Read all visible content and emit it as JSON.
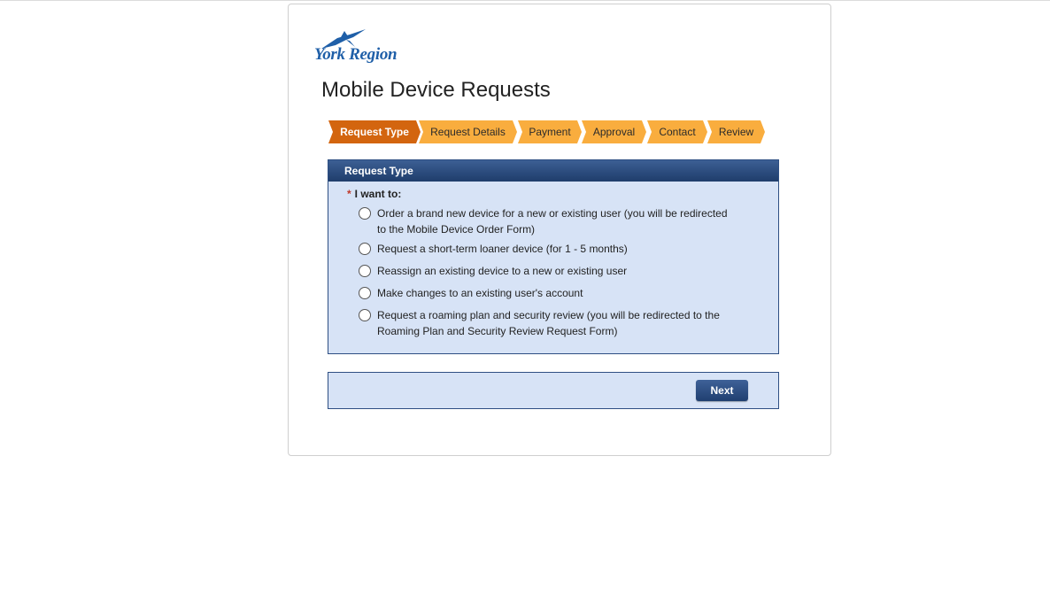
{
  "brand": {
    "logo_text": "York Region",
    "logo_color": "#1f5fa8",
    "logo_icon": "bird-icon"
  },
  "page": {
    "title": "Mobile Device Requests"
  },
  "steps": [
    {
      "label": "Request Type",
      "active": true
    },
    {
      "label": "Request Details",
      "active": false
    },
    {
      "label": "Payment",
      "active": false
    },
    {
      "label": "Approval",
      "active": false
    },
    {
      "label": "Contact",
      "active": false
    },
    {
      "label": "Review",
      "active": false
    }
  ],
  "colors": {
    "step_active": "#d3650f",
    "step_inactive": "#f9ad3e",
    "panel_header": "#2e4f83",
    "panel_bg": "#d7e3f6",
    "required": "#c0392b"
  },
  "request_type": {
    "header": "Request Type",
    "required_marker": "*",
    "question": "I want to:",
    "options": [
      {
        "label": "Order a brand new device for a new or existing user (you will be redirected to the Mobile Device Order Form)",
        "selected": false
      },
      {
        "label": "Request a short-term loaner device (for 1 - 5 months)",
        "selected": false
      },
      {
        "label": "Reassign an existing device to a new or existing user",
        "selected": false
      },
      {
        "label": "Make changes to an existing user's account",
        "selected": false
      },
      {
        "label": "Request a roaming plan and security review (you will be redirected to the Roaming Plan and Security Review Request Form)",
        "selected": false
      }
    ]
  },
  "actions": {
    "next_label": "Next"
  }
}
